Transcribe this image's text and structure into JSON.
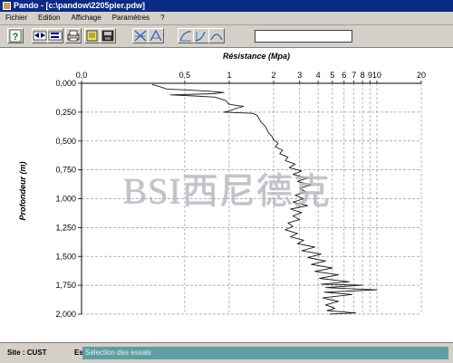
{
  "window": {
    "title": "Pando - [c:\\pandow\\2205pier.pdw]"
  },
  "menu": [
    {
      "label": "Fichier"
    },
    {
      "label": "Edition"
    },
    {
      "label": "Affichage"
    },
    {
      "label": "Paramètres"
    },
    {
      "label": "?"
    }
  ],
  "toolbar": {
    "buttons": [
      {
        "icon": "help-icon"
      },
      {
        "icon": "arrows-icon"
      },
      {
        "icon": "print-icon"
      },
      {
        "icon": "document-icon"
      },
      {
        "icon": "save-icon"
      },
      {
        "icon": "curve-1-icon"
      },
      {
        "icon": "curve-2-icon"
      },
      {
        "icon": "curve-3-icon"
      },
      {
        "icon": "curve-4-icon"
      }
    ],
    "field_value": ""
  },
  "chart_data": {
    "type": "line",
    "title": "Résistance (Mpa)",
    "xlabel": "Résistance (Mpa)",
    "ylabel": "Profondeur (m)",
    "xscale": "log",
    "xlim": [
      0.1,
      20
    ],
    "ylim": [
      2.0,
      0.0
    ],
    "x_ticks": [
      {
        "value": 0.1,
        "label": "0,0"
      },
      {
        "value": 0.5,
        "label": "0,5"
      },
      {
        "value": 1,
        "label": "1"
      },
      {
        "value": 2,
        "label": "2"
      },
      {
        "value": 3,
        "label": "3"
      },
      {
        "value": 4,
        "label": "4"
      },
      {
        "value": 5,
        "label": "5"
      },
      {
        "value": 6,
        "label": "6"
      },
      {
        "value": 7,
        "label": "7"
      },
      {
        "value": 8,
        "label": "8"
      },
      {
        "value": 9,
        "label": "9"
      },
      {
        "value": 10,
        "label": "10"
      },
      {
        "value": 20,
        "label": "20"
      }
    ],
    "y_ticks": [
      {
        "value": 0.0,
        "label": "0,000"
      },
      {
        "value": 0.25,
        "label": "0,250"
      },
      {
        "value": 0.5,
        "label": "0,500"
      },
      {
        "value": 0.75,
        "label": "0,750"
      },
      {
        "value": 1.0,
        "label": "1,000"
      },
      {
        "value": 1.25,
        "label": "1,250"
      },
      {
        "value": 1.5,
        "label": "1,500"
      },
      {
        "value": 1.75,
        "label": "1,750"
      },
      {
        "value": 2.0,
        "label": "2,000"
      }
    ],
    "grid": true,
    "series": [
      {
        "color": "#1a1a1a",
        "points": [
          [
            0.3,
            0.01
          ],
          [
            0.34,
            0.03
          ],
          [
            0.38,
            0.05
          ],
          [
            0.55,
            0.06
          ],
          [
            0.75,
            0.07
          ],
          [
            0.92,
            0.08
          ],
          [
            0.78,
            0.09
          ],
          [
            0.4,
            0.1
          ],
          [
            0.58,
            0.11
          ],
          [
            0.8,
            0.12
          ],
          [
            0.95,
            0.15
          ],
          [
            0.99,
            0.18
          ],
          [
            1.1,
            0.19
          ],
          [
            1.25,
            0.2
          ],
          [
            1.1,
            0.22
          ],
          [
            1.0,
            0.24
          ],
          [
            0.92,
            0.25
          ],
          [
            1.45,
            0.26
          ],
          [
            1.55,
            0.28
          ],
          [
            1.6,
            0.31
          ],
          [
            1.65,
            0.34
          ],
          [
            1.75,
            0.37
          ],
          [
            1.8,
            0.4
          ],
          [
            1.85,
            0.43
          ],
          [
            1.95,
            0.46
          ],
          [
            2.0,
            0.49
          ],
          [
            2.15,
            0.52
          ],
          [
            2.05,
            0.55
          ],
          [
            2.3,
            0.58
          ],
          [
            2.2,
            0.61
          ],
          [
            2.5,
            0.64
          ],
          [
            2.4,
            0.67
          ],
          [
            2.8,
            0.7
          ],
          [
            2.55,
            0.73
          ],
          [
            3.1,
            0.76
          ],
          [
            2.7,
            0.79
          ],
          [
            3.4,
            0.82
          ],
          [
            2.9,
            0.85
          ],
          [
            3.6,
            0.88
          ],
          [
            3.0,
            0.91
          ],
          [
            3.3,
            0.94
          ],
          [
            2.8,
            0.97
          ],
          [
            3.2,
            1.0
          ],
          [
            2.7,
            1.03
          ],
          [
            3.4,
            1.06
          ],
          [
            2.6,
            1.09
          ],
          [
            3.1,
            1.12
          ],
          [
            2.7,
            1.15
          ],
          [
            3.0,
            1.18
          ],
          [
            2.5,
            1.21
          ],
          [
            2.7,
            1.24
          ],
          [
            2.4,
            1.27
          ],
          [
            2.9,
            1.3
          ],
          [
            2.6,
            1.33
          ],
          [
            3.2,
            1.36
          ],
          [
            2.9,
            1.39
          ],
          [
            3.8,
            1.42
          ],
          [
            3.1,
            1.45
          ],
          [
            4.2,
            1.48
          ],
          [
            3.4,
            1.51
          ],
          [
            4.5,
            1.54
          ],
          [
            3.6,
            1.57
          ],
          [
            5.0,
            1.6
          ],
          [
            3.8,
            1.63
          ],
          [
            5.5,
            1.66
          ],
          [
            4.1,
            1.69
          ],
          [
            6.5,
            1.72
          ],
          [
            4.2,
            1.74
          ],
          [
            8.0,
            1.75
          ],
          [
            4.5,
            1.77
          ],
          [
            10.0,
            1.79
          ],
          [
            4.4,
            1.81
          ],
          [
            6.8,
            1.83
          ],
          [
            4.3,
            1.86
          ],
          [
            5.5,
            1.89
          ],
          [
            4.5,
            1.92
          ],
          [
            5.2,
            1.95
          ],
          [
            4.6,
            1.97
          ],
          [
            7.2,
            1.99
          ],
          [
            4.8,
            2.0
          ]
        ]
      }
    ]
  },
  "watermark": "BSI西尼德克",
  "status": {
    "site_label": "Site : CUST",
    "essai_label": "Ess",
    "panel_text": "Sélection des essais"
  }
}
